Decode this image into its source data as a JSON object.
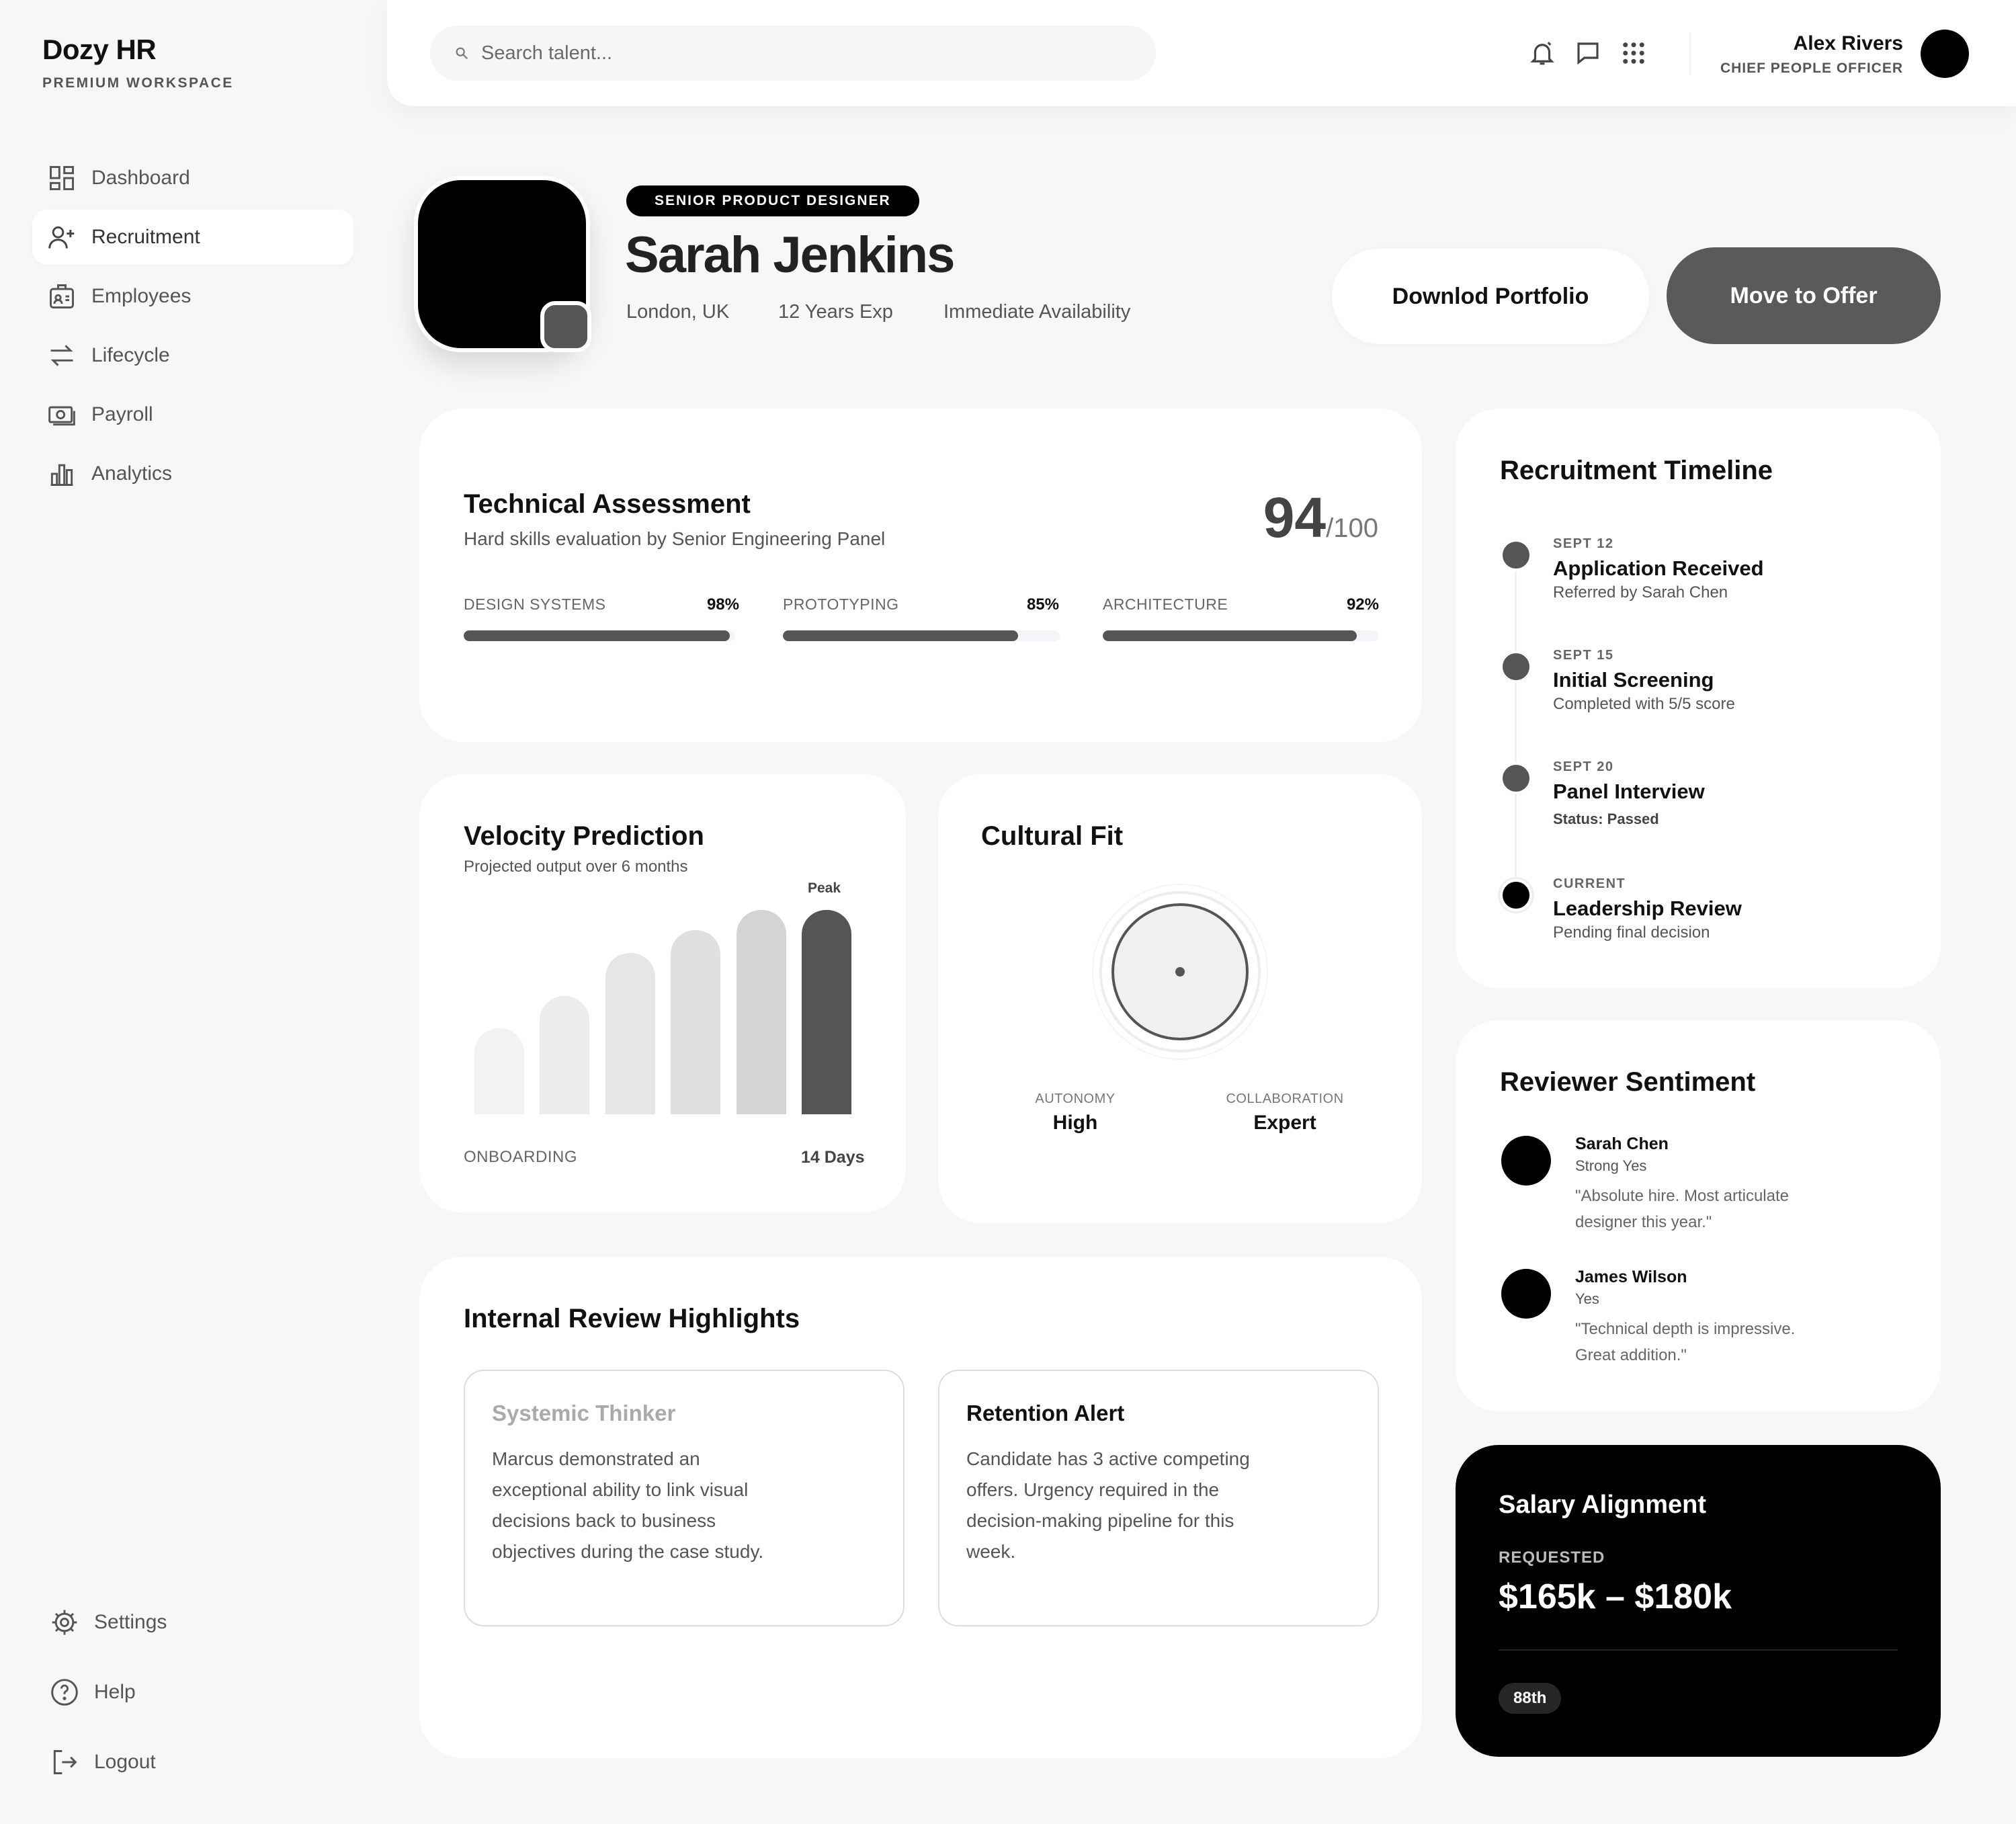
{
  "brand": {
    "title": "Dozy HR",
    "subtitle": "PREMIUM WORKSPACE"
  },
  "sidebar": {
    "items": [
      {
        "label": "Dashboard",
        "icon": "dashboard-icon"
      },
      {
        "label": "Recruitment",
        "icon": "user-plus-icon",
        "active": true
      },
      {
        "label": "Employees",
        "icon": "badge-icon"
      },
      {
        "label": "Lifecycle",
        "icon": "swap-icon"
      },
      {
        "label": "Payroll",
        "icon": "cash-icon"
      },
      {
        "label": "Analytics",
        "icon": "chart-icon"
      }
    ],
    "bottom": [
      {
        "label": "Settings",
        "icon": "gear-icon"
      },
      {
        "label": "Help",
        "icon": "help-icon"
      },
      {
        "label": "Logout",
        "icon": "logout-icon"
      }
    ]
  },
  "header": {
    "search_placeholder": "Search talent...",
    "user_name": "Alex Rivers",
    "user_role": "CHIEF PEOPLE OFFICER"
  },
  "profile": {
    "role": "SENIOR PRODUCT DESIGNER",
    "name": "Sarah Jenkins",
    "location": "London, UK",
    "experience": "12 Years Exp",
    "availability": "Immediate Availability",
    "download_label": "Downlod Portfolio",
    "offer_label": "Move to Offer"
  },
  "assessment": {
    "title": "Technical Assessment",
    "subtitle": "Hard skills evaluation by Senior Engineering Panel",
    "score": "94",
    "score_max": "/100",
    "skills": [
      {
        "label": "DESIGN SYSTEMS",
        "value": "98%",
        "pct": 98
      },
      {
        "label": "PROTOTYPING",
        "value": "85%",
        "pct": 85
      },
      {
        "label": "ARCHITECTURE",
        "value": "92%",
        "pct": 92
      }
    ]
  },
  "velocity": {
    "title": "Velocity Prediction",
    "subtitle": "Projected output over 6 months",
    "peak_label": "Peak",
    "x_label": "ONBOARDING",
    "x_value": "14 Days",
    "bar_colors": [
      "#f2f2f2",
      "#ececec",
      "#e6e6e6",
      "#e0e0e0",
      "#d4d4d4",
      "#555555"
    ]
  },
  "chart_data": {
    "type": "bar",
    "title": "Velocity Prediction",
    "subtitle": "Projected output over 6 months",
    "values": [
      0.42,
      0.58,
      0.79,
      0.9,
      1.0,
      1.0
    ],
    "annotations": [
      "Peak"
    ],
    "ylim": [
      0,
      1
    ]
  },
  "cultural_fit": {
    "title": "Cultural Fit",
    "metrics": [
      {
        "label": "AUTONOMY",
        "value": "High"
      },
      {
        "label": "COLLABORATION",
        "value": "Expert"
      }
    ]
  },
  "highlights": {
    "title": "Internal Review Highlights",
    "items": [
      {
        "title": "Systemic Thinker",
        "text": "Marcus demonstrated an exceptional ability to link visual decisions back to business objectives during the case study."
      },
      {
        "title": "Retention Alert",
        "text": "Candidate has 3 active competing offers. Urgency required in the decision-making pipeline for this week."
      }
    ]
  },
  "timeline": {
    "title": "Recruitment Timeline",
    "events": [
      {
        "date": "SEPT 12",
        "title": "Application Received",
        "sub": "Referred by Sarah Chen"
      },
      {
        "date": "SEPT 15",
        "title": "Initial Screening",
        "sub": "Completed with 5/5 score"
      },
      {
        "date": "SEPT 20",
        "title": "Panel Interview",
        "sub": "Status: Passed"
      },
      {
        "date": "CURRENT",
        "title": "Leadership Review",
        "sub": "Pending final decision"
      }
    ]
  },
  "sentiment": {
    "title": "Reviewer Sentiment",
    "reviews": [
      {
        "name": "Sarah Chen",
        "verdict": "Strong Yes",
        "quote": "\"Absolute hire. Most articulate designer this year.\""
      },
      {
        "name": "James Wilson",
        "verdict": "Yes",
        "quote": "\"Technical depth is impressive. Great addition.\""
      }
    ]
  },
  "salary": {
    "title": "Salary Alignment",
    "label": "REQUESTED",
    "value": "$165k – $180k",
    "percentile": "88th"
  }
}
